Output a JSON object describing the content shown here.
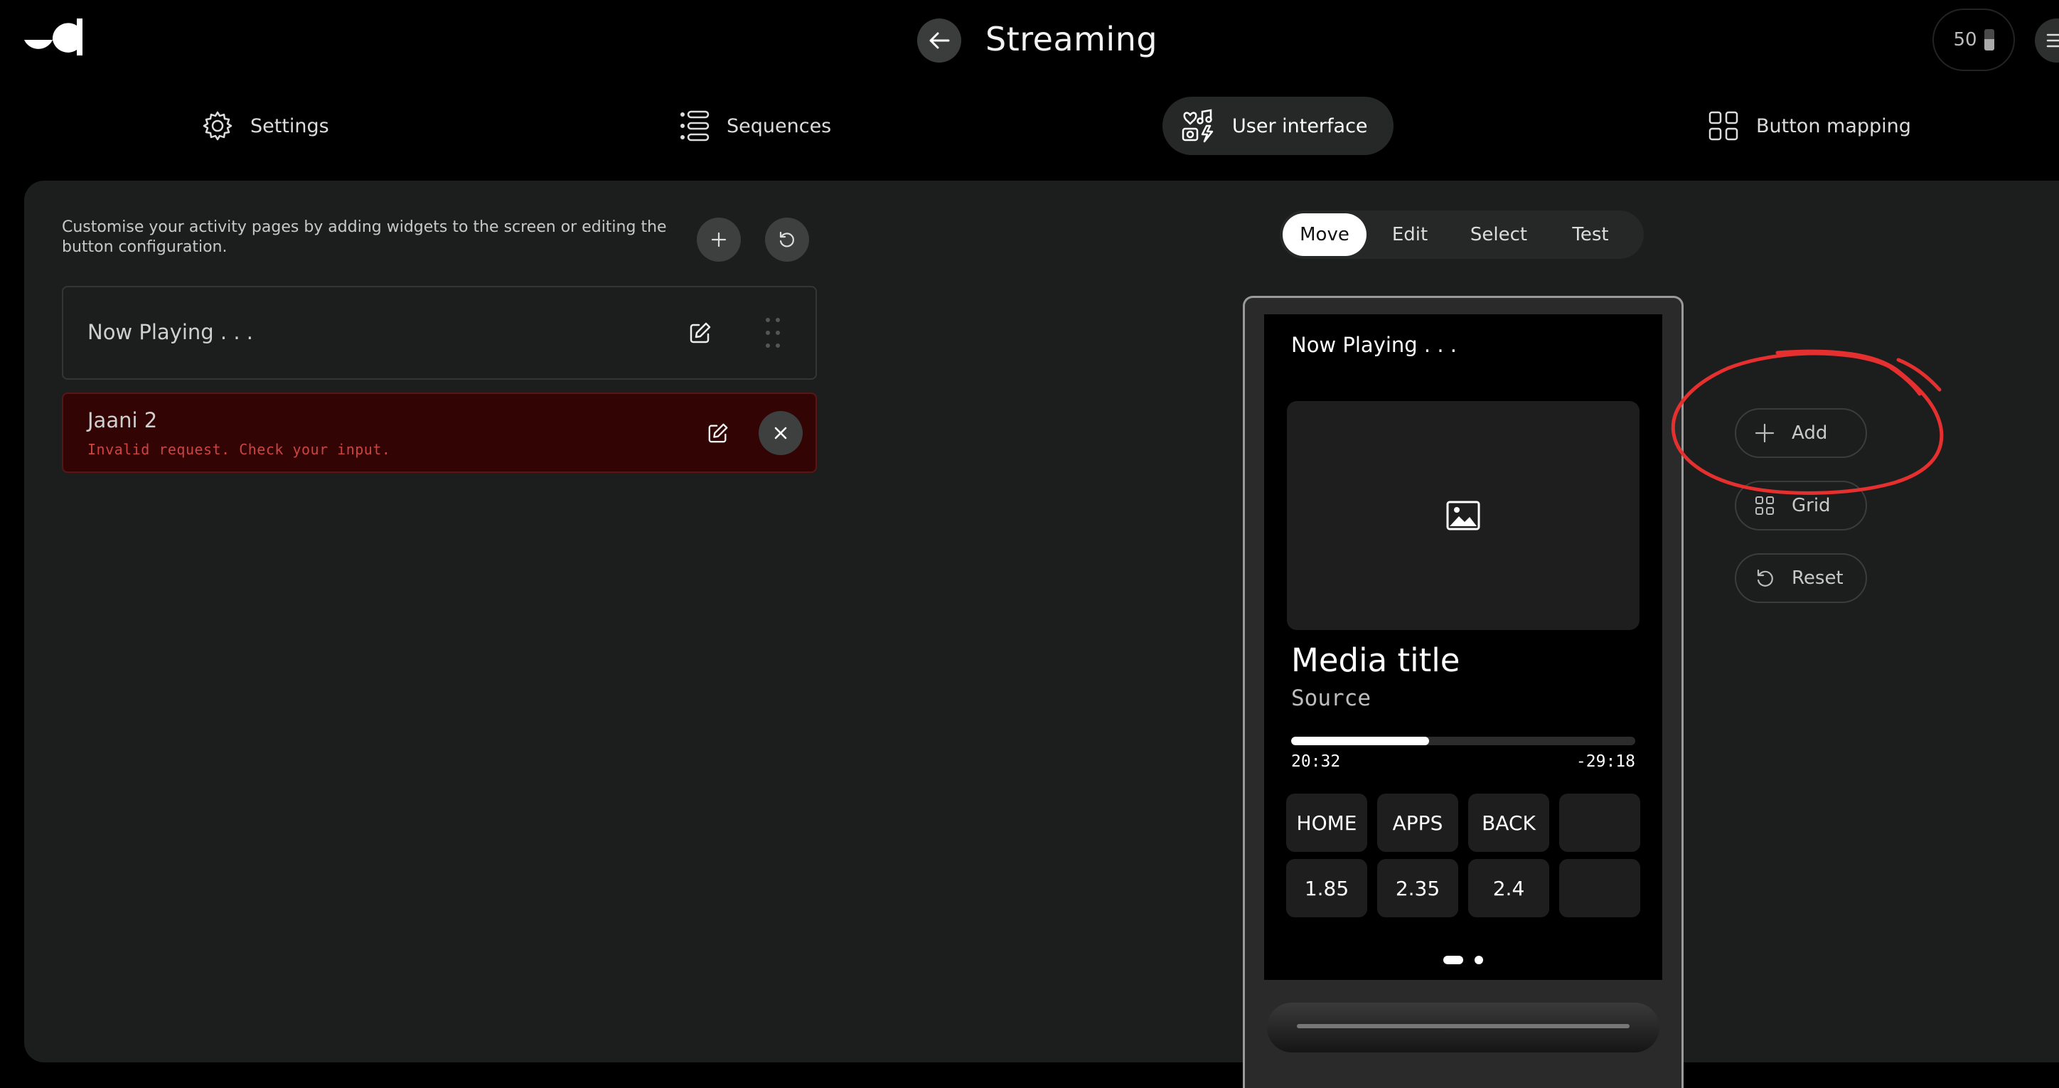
{
  "header": {
    "title": "Streaming",
    "battery_level": "50",
    "battery_fraction": 0.55
  },
  "tabs": [
    {
      "label": "Settings",
      "icon": "gear-icon",
      "active": false
    },
    {
      "label": "Sequences",
      "icon": "list-icon",
      "active": false
    },
    {
      "label": "User interface",
      "icon": "user-interface-icon",
      "active": true
    },
    {
      "label": "Button mapping",
      "icon": "grid-icon",
      "active": false
    }
  ],
  "left_panel": {
    "description": "Customise your activity pages by adding widgets to the screen or editing the button configuration.",
    "items": [
      {
        "label": "Now Playing . . ."
      },
      {
        "label": "Jaani 2",
        "error": "Invalid request. Check your input."
      }
    ]
  },
  "mode_control": {
    "options": [
      "Move",
      "Edit",
      "Select",
      "Test"
    ],
    "selected": "Move"
  },
  "device_preview": {
    "page_title": "Now Playing . . .",
    "media_title": "Media title",
    "source": "Source",
    "progress_fraction": 0.4,
    "elapsed": "20:32",
    "remaining": "-29:18",
    "buttons_row1": [
      "HOME",
      "APPS",
      "BACK",
      ""
    ],
    "buttons_row2": [
      "1.85",
      "2.35",
      "2.4",
      ""
    ],
    "page_count": 2,
    "current_page": 1
  },
  "tools": {
    "add_label": "Add",
    "grid_label": "Grid",
    "reset_label": "Reset"
  },
  "colors": {
    "background": "#000000",
    "panel": "#1c1e1e",
    "error_background": "#330404",
    "error_text": "#cc4444",
    "annotation": "#e5302f"
  }
}
